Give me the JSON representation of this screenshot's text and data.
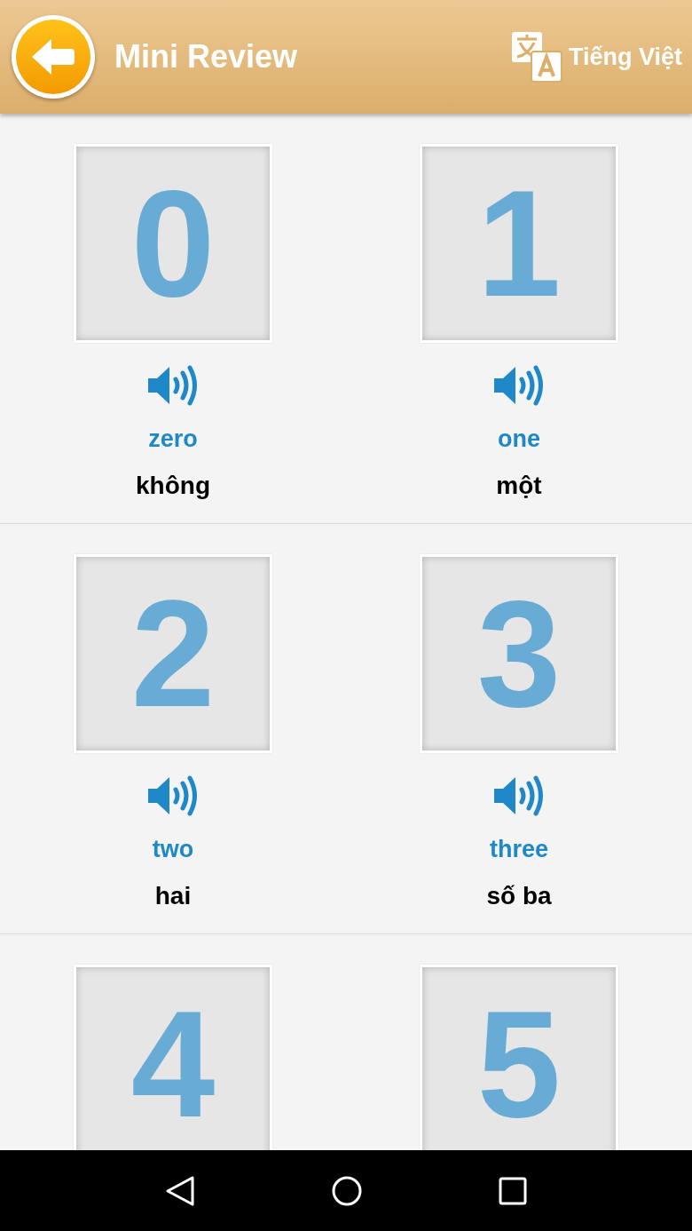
{
  "header": {
    "title": "Mini Review",
    "language": "Tiếng Việt"
  },
  "cards": [
    {
      "digit": "0",
      "english": "zero",
      "vietnamese": "không"
    },
    {
      "digit": "1",
      "english": "one",
      "vietnamese": "một"
    },
    {
      "digit": "2",
      "english": "two",
      "vietnamese": "hai"
    },
    {
      "digit": "3",
      "english": "three",
      "vietnamese": "số ba"
    },
    {
      "digit": "4"
    },
    {
      "digit": "5"
    }
  ]
}
